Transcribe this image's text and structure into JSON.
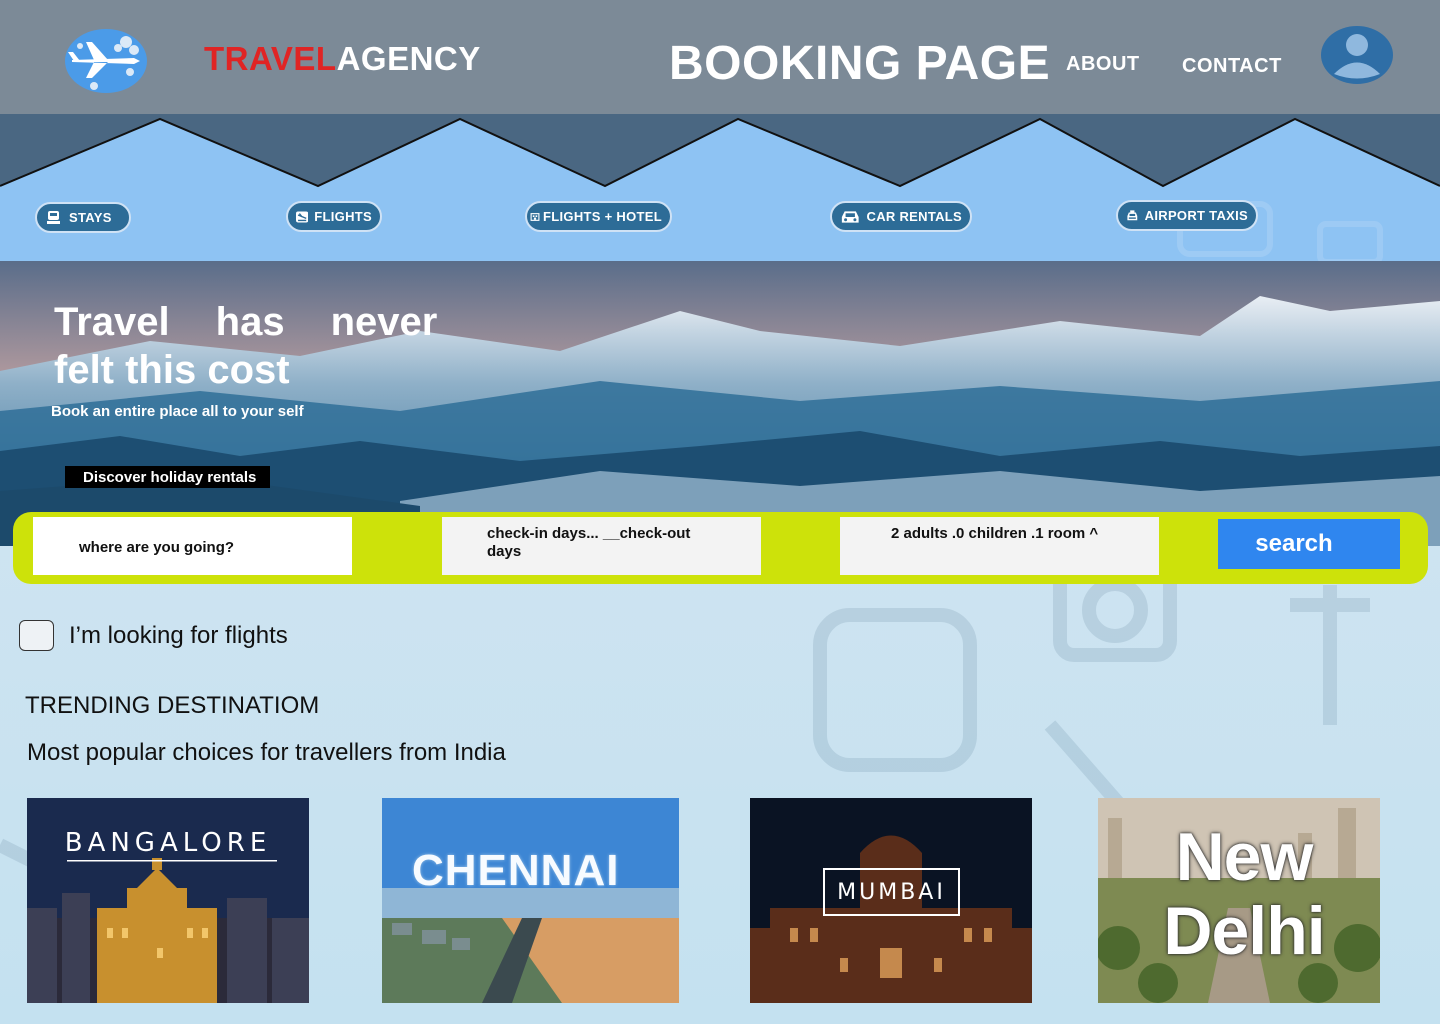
{
  "header": {
    "brand_red": "TRAVEL",
    "brand_rest": "AGENCY",
    "page_title": "BOOKING PAGE",
    "nav": {
      "about": "ABOUT",
      "contact": "CONTACT"
    },
    "logo_icon": "airplane-globe-icon",
    "avatar_icon": "user-avatar-icon"
  },
  "categories": [
    {
      "label": "STAYS",
      "icon": "bed-icon"
    },
    {
      "label": "FLIGHTS",
      "icon": "airplane-icon"
    },
    {
      "label": "FLIGHTS + HOTEL",
      "icon": "hotel-icon"
    },
    {
      "label": "CAR RENTALS",
      "icon": "car-icon"
    },
    {
      "label": "AIRPORT TAXIS",
      "icon": "taxi-icon"
    }
  ],
  "hero": {
    "title_words": [
      "Travel",
      "has",
      "never"
    ],
    "title_line2": "felt this cost",
    "subtitle": "Book an entire place all to your self",
    "cta": "Discover holiday rentals"
  },
  "search": {
    "destination_placeholder": "where are you going?",
    "dates": "check-in days...  __check-out days",
    "guests": "2 adults .0 children .1 room ^",
    "button": "search"
  },
  "flights_checkbox": {
    "label": "I’m looking for flights",
    "checked": false
  },
  "trending": {
    "title": "TRENDING DESTINATIOM",
    "subtitle": "Most popular choices for travellers from India",
    "cards": [
      {
        "label": "BANGALORE"
      },
      {
        "label": "CHENNAI"
      },
      {
        "label": "MUMBAI"
      },
      {
        "label_line1": "New",
        "label_line2": "Delhi"
      }
    ]
  },
  "colors": {
    "header_bg": "#7c8a97",
    "brand_red": "#e02424",
    "category_btn": "#2d6c97",
    "search_bar": "#cde20a",
    "search_button": "#2f86ef"
  }
}
